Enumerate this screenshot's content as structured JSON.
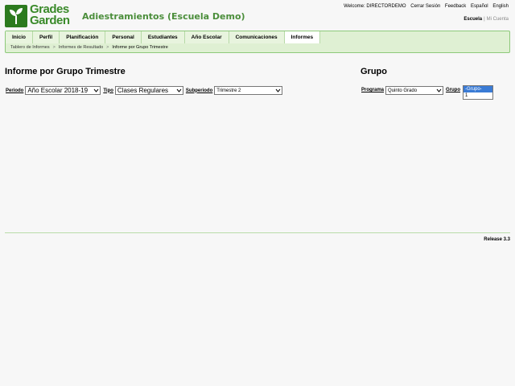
{
  "header": {
    "logo_line1": "Grades",
    "logo_line2": "Garden",
    "school_title": "Adiestramientos (Escuela Demo)",
    "welcome": "Welcome: DIRECTORDEMO",
    "logout": "Cerrar Sesión",
    "feedback": "Feedback",
    "lang_es": "Español",
    "lang_en": "English",
    "scope_active": "Escuela",
    "scope_sep": "|",
    "scope_other": "Mi Cuenta"
  },
  "nav": {
    "tabs": [
      {
        "label": "Inicio"
      },
      {
        "label": "Perfil"
      },
      {
        "label": "Planificación"
      },
      {
        "label": "Personal"
      },
      {
        "label": "Estudiantes"
      },
      {
        "label": "Año Escolar"
      },
      {
        "label": "Comunicaciones"
      },
      {
        "label": "Informes"
      }
    ],
    "breadcrumb": [
      "Tablero de Informes",
      "Informes de Resultado",
      "Informe por Grupo Trimestre"
    ],
    "breadcrumb_sep": ">"
  },
  "main": {
    "title": "Informe por Grupo Trimestre",
    "filters": {
      "periodo_label": "Periodo",
      "periodo_value": "Año Escolar 2018-19",
      "tipo_label": "Tipo",
      "tipo_value": "Clases Regulares",
      "subperiodo_label": "Subperiodo",
      "subperiodo_value": "Trimestre 2"
    }
  },
  "grupo_panel": {
    "title": "Grupo",
    "programa_label": "Programa",
    "programa_value": "Quinto Grado",
    "grupo_label": "Grupo",
    "grupo_options": [
      "-Grupo-",
      "1"
    ]
  },
  "footer": {
    "release": "Release 3.3"
  },
  "colors": {
    "brand_green": "#2c7a1e",
    "title_green": "#4b8e3b",
    "nav_bg": "#dff0d3",
    "select_highlight": "#3a7bd5"
  }
}
